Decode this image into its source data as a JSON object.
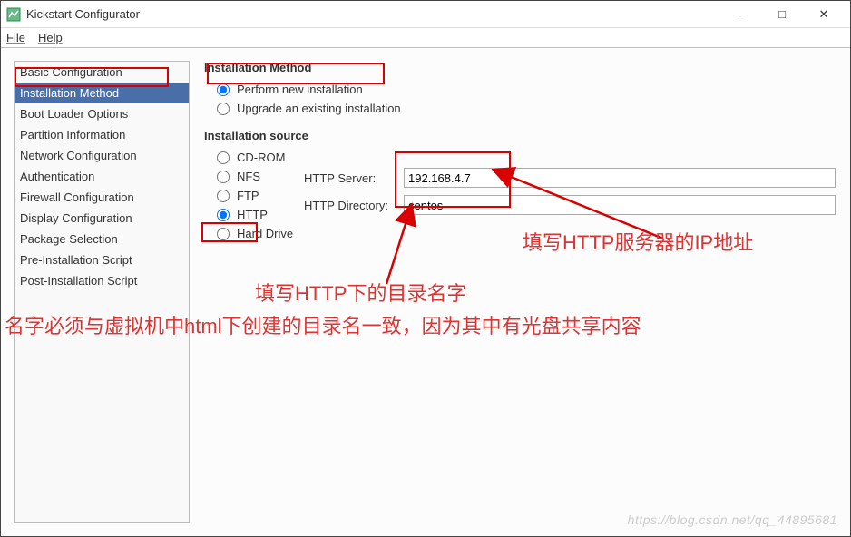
{
  "window": {
    "title": "Kickstart Configurator"
  },
  "menu": {
    "file": "File",
    "help": "Help"
  },
  "win_controls": {
    "min": "—",
    "max": "□",
    "close": "✕"
  },
  "sidebar": {
    "items": [
      {
        "label": "Basic Configuration"
      },
      {
        "label": "Installation Method"
      },
      {
        "label": "Boot Loader Options"
      },
      {
        "label": "Partition Information"
      },
      {
        "label": "Network Configuration"
      },
      {
        "label": "Authentication"
      },
      {
        "label": "Firewall Configuration"
      },
      {
        "label": "Display Configuration"
      },
      {
        "label": "Package Selection"
      },
      {
        "label": "Pre-Installation Script"
      },
      {
        "label": "Post-Installation Script"
      }
    ],
    "selected_index": 1
  },
  "content": {
    "method_title": "Installation Method",
    "method_opts": {
      "new": "Perform new installation",
      "upgrade": "Upgrade an existing installation"
    },
    "source_title": "Installation source",
    "source_opts": {
      "cdrom": "CD-ROM",
      "nfs": "NFS",
      "ftp": "FTP",
      "http": "HTTP",
      "hd": "Hard Drive"
    },
    "fields": {
      "server_label": "HTTP Server:",
      "server_value": "192.168.4.7",
      "dir_label": "HTTP Directory:",
      "dir_value": "centos"
    }
  },
  "annotations": {
    "right1": "填写HTTP服务器的IP地址",
    "left1": "填写HTTP下的目录名字",
    "left2": "名字必须与虚拟机中html下创建的目录名一致，因为其中有光盘共享内容"
  },
  "watermark": "https://blog.csdn.net/qq_44895681"
}
